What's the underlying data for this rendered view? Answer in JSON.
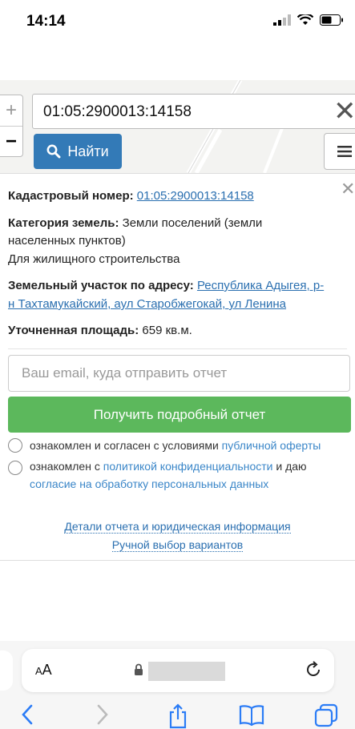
{
  "status_bar": {
    "time": "14:14"
  },
  "map": {
    "search_value": "01:05:2900013:14158",
    "find_label": "Найти",
    "zoom_in": "+",
    "zoom_out": "−"
  },
  "panel": {
    "cadastral_label": "Кадастровый номер:",
    "cadastral_value": "01:05:2900013:14158",
    "category_label": "Категория земель:",
    "category_value": "Земли поселений (земли",
    "category_value2": "населенных пунктов)",
    "usage": "Для жилищного строительства",
    "address_label": "Земельный участок по адресу:",
    "address_value1": "Республика Адыгея, р-",
    "address_value2": "н Тахтамукайский, аул Старобжегокай, ул Ленина",
    "area_label": "Уточненная площадь:",
    "area_value": "659 кв.м.",
    "email_placeholder": "Ваш email, куда отправить отчет",
    "report_button": "Получить подробный отчет",
    "consent1_text": "ознакомлен и согласен с условиями ",
    "consent1_link": "публичной оферты",
    "consent2_text": "ознакомлен с ",
    "consent2_link": "политикой конфиденциальности",
    "consent2_text2": " и даю",
    "consent2_link2": "согласие на обработку персональных данных",
    "details_link": "Детали отчета и юридическая информация",
    "manual_link": "Ручной выбор вариантов"
  },
  "safari": {
    "text_size": "AA"
  },
  "colors": {
    "primary": "#337ab7",
    "success": "#5cb85c",
    "link": "#2a6fb0"
  }
}
